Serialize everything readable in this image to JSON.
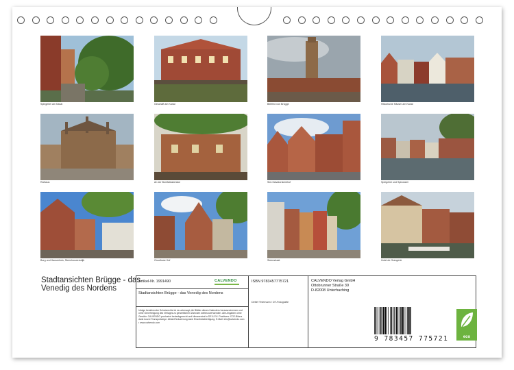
{
  "photos": [
    {
      "caption": "Spiegelrei am Kanal"
    },
    {
      "caption": "Geschäft am Kanal"
    },
    {
      "caption": "Belfried von Brügge"
    },
    {
      "caption": "Historische Häuser am Kanal"
    },
    {
      "caption": "Rathaus"
    },
    {
      "caption": "An der Bonifatiusbrücke"
    },
    {
      "caption": "Sint-Salvatorskerkhof"
    },
    {
      "caption": "Spiegelrei und Spinolarei"
    },
    {
      "caption": "Burg und Hauserhuis, Steenhouwersdijk"
    },
    {
      "caption": "Gruuthuse Hof"
    },
    {
      "caption": "Steenstraat"
    },
    {
      "caption": "Hotel de Orangerie"
    }
  ],
  "back": {
    "title": "Stadtansichten Brügge - das Venedig des Nordens",
    "article_no": "Artikel-Nr. 1991490",
    "publisher_brand": "CALVENDO",
    "box_title": "Stadtansichten Brügge - das Venedig des Nordens",
    "fine_print": "Infolge bestehender Schutzrechte ist es untersagt, die Blätter dieses Kalenders herauszutrennen und ohne Genehmigung des Verlages zu gewerblichen Zwecken weiterzuverwenden. Alle Angaben ohne Gewähr. CALVENDO produziert bedarfsgerecht und klimaneutral in DE & EU. Positivers: CO2-Bilanz dank kurzer Transportwege. Abfall-Reduzierung dank Einzelstückfertigung. E-Mail: info@calvendo.com • www.calvendo.com",
    "isbn": "ISBN 9783457775721",
    "author": "Detlef Thiemann / DT-Fotografie",
    "publisher_name": "CALVENDO Verlag GmbH",
    "publisher_street": "Ottobrunner Straße 39",
    "publisher_city": "D-82008 Unterhaching",
    "barcode_number": "9 783457 775721",
    "eco_label": "eco"
  }
}
